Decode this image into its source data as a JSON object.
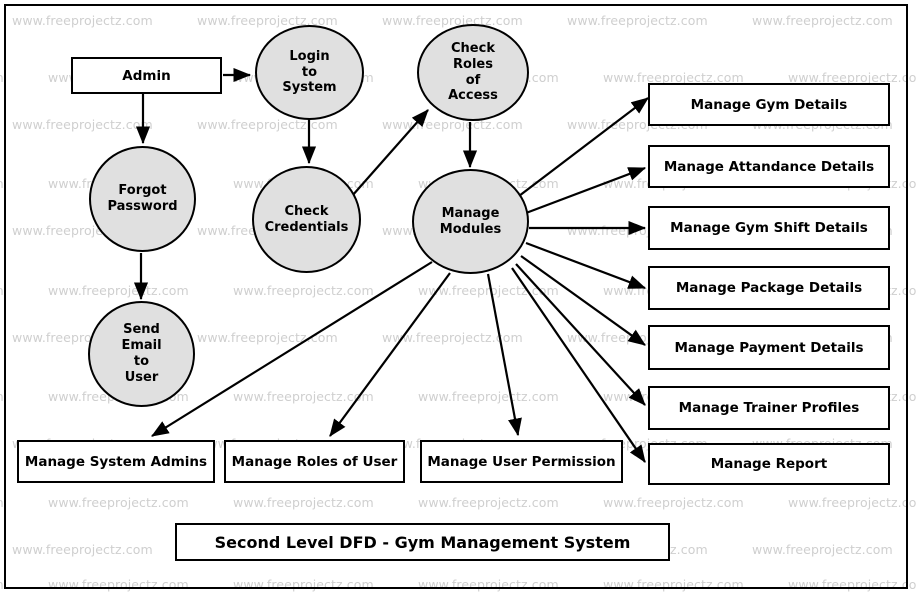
{
  "diagram": {
    "title": "Second Level DFD - Gym Management System",
    "watermark_text": "www.freeprojectz.com",
    "colors": {
      "process_fill": "#e0e0e0",
      "entity_fill": "#ffffff",
      "stroke": "#000000",
      "watermark": "#cfcfcf",
      "background": "#ffffff"
    },
    "external_entity": {
      "label": "Admin"
    },
    "processes": [
      {
        "id": "login",
        "label": "Login\nto\nSystem"
      },
      {
        "id": "check_roles",
        "label": "Check\nRoles\nof\nAccess"
      },
      {
        "id": "forgot",
        "label": "Forgot\nPassword"
      },
      {
        "id": "check_cred",
        "label": "Check\nCredentials"
      },
      {
        "id": "send_email",
        "label": "Send\nEmail\nto\nUser"
      },
      {
        "id": "manage_mod",
        "label": "Manage\nModules"
      }
    ],
    "process_labels": {
      "login": [
        "Login",
        "to",
        "System"
      ],
      "check_roles": [
        "Check",
        "Roles",
        "of",
        "Access"
      ],
      "forgot": [
        "Forgot",
        "Password"
      ],
      "check_cred": [
        "Check",
        "Credentials"
      ],
      "send_email": [
        "Send",
        "Email",
        "to",
        "User"
      ],
      "manage_mod": [
        "Manage",
        "Modules"
      ]
    },
    "right_modules": [
      {
        "label": "Manage Gym Details"
      },
      {
        "label": "Manage Attandance Details"
      },
      {
        "label": "Manage Gym Shift Details"
      },
      {
        "label": "Manage Package Details"
      },
      {
        "label": "Manage Payment Details"
      },
      {
        "label": "Manage Trainer Profiles"
      },
      {
        "label": "Manage Report"
      }
    ],
    "bottom_modules": [
      {
        "label": "Manage System Admins"
      },
      {
        "label": "Manage Roles of User"
      },
      {
        "label": "Manage User Permission"
      }
    ]
  }
}
